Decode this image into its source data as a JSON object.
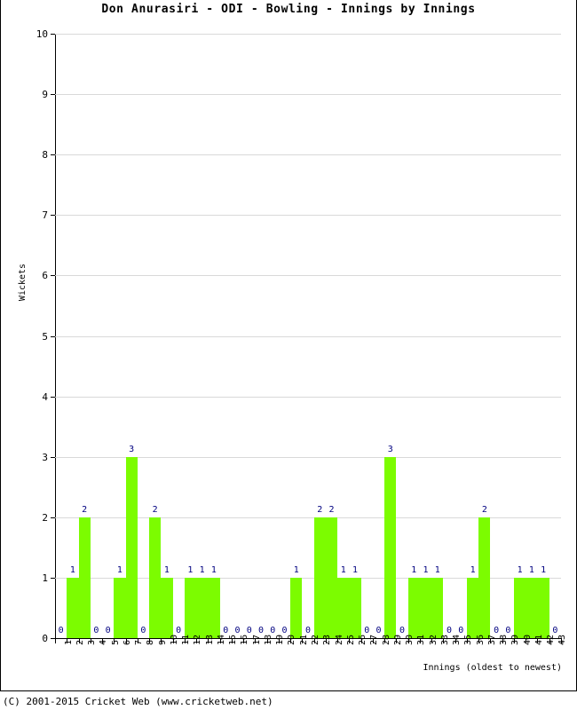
{
  "chart_data": {
    "type": "bar",
    "title": "Don Anurasiri - ODI - Bowling - Innings by Innings",
    "xlabel": "Innings (oldest to newest)",
    "ylabel": "Wickets",
    "categories": [
      "1",
      "2",
      "3",
      "4",
      "5",
      "6",
      "7",
      "8",
      "9",
      "10",
      "11",
      "12",
      "13",
      "14",
      "15",
      "16",
      "17",
      "18",
      "19",
      "20",
      "21",
      "22",
      "23",
      "24",
      "25",
      "26",
      "27",
      "28",
      "29",
      "30",
      "31",
      "32",
      "33",
      "34",
      "35",
      "36",
      "37",
      "38",
      "39",
      "40",
      "41",
      "42",
      "43"
    ],
    "values": [
      0,
      1,
      2,
      0,
      0,
      1,
      3,
      0,
      2,
      1,
      0,
      1,
      1,
      1,
      0,
      0,
      0,
      0,
      0,
      0,
      1,
      0,
      2,
      2,
      1,
      1,
      0,
      0,
      3,
      0,
      1,
      1,
      1,
      0,
      0,
      1,
      2,
      0,
      0,
      1,
      1,
      1,
      0
    ],
    "ylim": [
      0,
      10
    ],
    "yticks": [
      "0",
      "1",
      "2",
      "3",
      "4",
      "5",
      "6",
      "7",
      "8",
      "9",
      "10"
    ],
    "grid": true,
    "legend": "none",
    "bar_color": "#7cfc00",
    "label_color": "#000080",
    "axis_color": "#000000",
    "grid_color": "#d9d9d9",
    "background": "#ffffff",
    "data_labels_shown": true
  },
  "footer": {
    "copyright": "(C) 2001-2015 Cricket Web (www.cricketweb.net)"
  }
}
